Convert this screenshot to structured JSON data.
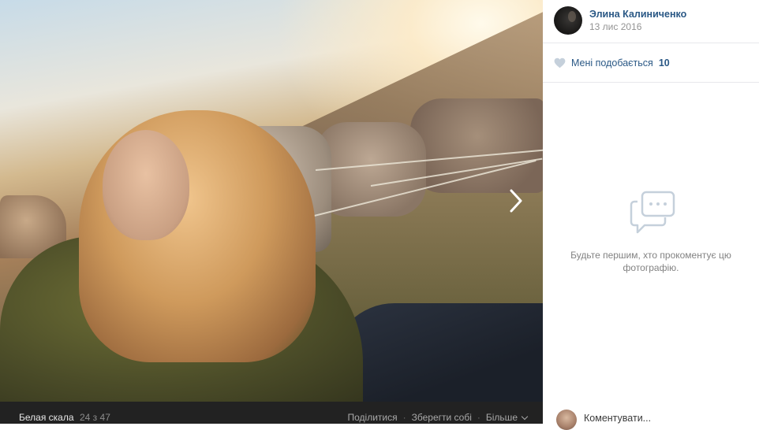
{
  "photo": {
    "album_name": "Белая скала",
    "counter": "24 з 47",
    "actions": [
      "Поділитися",
      "Зберегти собі",
      "Більше"
    ],
    "next_icon": "chevron-right-icon"
  },
  "post": {
    "author_name": "Элина Калиниченко",
    "date": "13 лис 2016",
    "likes_label": "Мені подобається",
    "likes_count": "10"
  },
  "comments": {
    "empty_text": "Будьте першим, хто прокоментує цю фотографію.",
    "input_placeholder": "Коментувати..."
  },
  "colors": {
    "link": "#2a5885",
    "muted": "#939393",
    "photo_bar_bg": "#222222"
  }
}
